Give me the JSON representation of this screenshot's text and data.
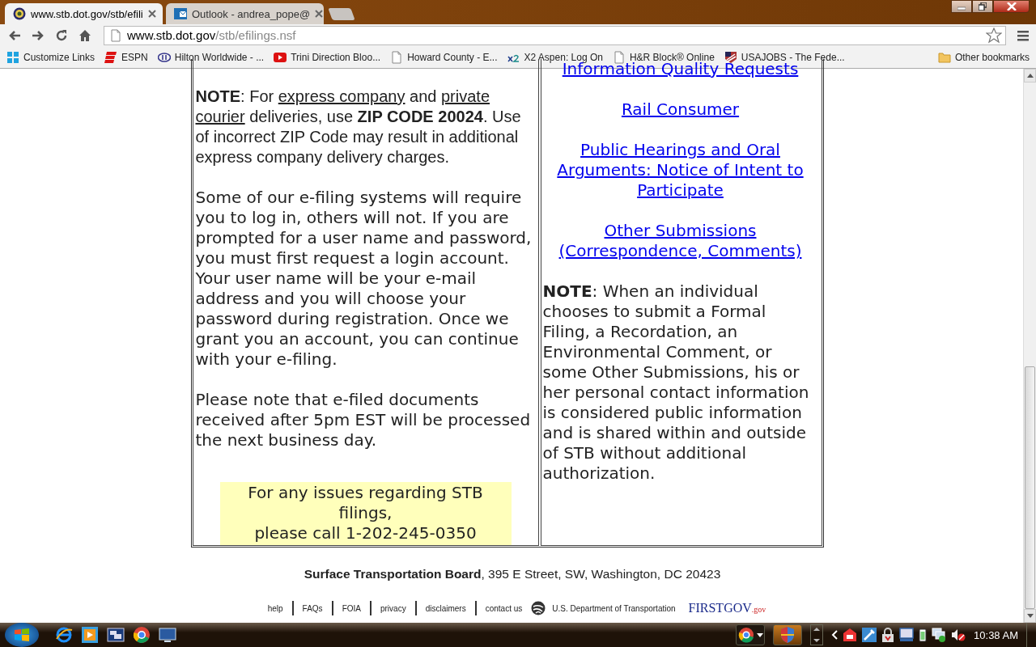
{
  "tabs": [
    {
      "title": "www.stb.dot.gov/stb/efili",
      "selected": true
    },
    {
      "title": "Outlook - andrea_pope@",
      "selected": false
    }
  ],
  "address": {
    "host": "www.stb.dot.gov",
    "path": "/stb/efilings.nsf"
  },
  "bookmarks": [
    {
      "label": "Customize Links"
    },
    {
      "label": "ESPN"
    },
    {
      "label": "Hilton Worldwide - ..."
    },
    {
      "label": "Trini Direction Bloo..."
    },
    {
      "label": "Howard County - E..."
    },
    {
      "label": "X2 Aspen: Log On"
    },
    {
      "label": "H&R Block® Online"
    },
    {
      "label": "USAJOBS - The Fede..."
    }
  ],
  "other_bookmarks": "Other bookmarks",
  "left_column": {
    "note": [
      {
        "text": "NOTE",
        "kind": "bold"
      },
      {
        "text": ": For ",
        "kind": "plain"
      },
      {
        "text": "express company",
        "kind": "underline"
      },
      {
        "text": " and ",
        "kind": "plain"
      },
      {
        "text": "private courier",
        "kind": "underline"
      },
      {
        "text": " deliveries, use ",
        "kind": "plain"
      },
      {
        "text": "ZIP CODE 20024",
        "kind": "bold"
      },
      {
        "text": ". Use of incorrect ZIP Code may result in additional express company delivery charges.",
        "kind": "plain"
      }
    ],
    "paragraphs": [
      "Some of our e-filing systems will require you to log in, others will not. If you are prompted for a user name and password, you must first request a login account. Your user name will be your e-mail address and you will choose your password during registration. Once we grant you an account, you can continue with your e-filing.",
      "Please note that e-filed documents received after 5pm EST will be processed the next business day."
    ],
    "notice": [
      "For any issues regarding STB filings,",
      "please call 1-202-245-0350"
    ]
  },
  "right_column": {
    "links": [
      "Information Quality Requests",
      "Rail Consumer",
      "Public Hearings and Oral Arguments: Notice of Intent to Participate",
      "Other Submissions (Correspondence, Comments)"
    ],
    "note": "**NOTE**: When an individual chooses to submit a Formal Filing, a Recordation, an Environmental Comment, or some Other Submissions, his or her personal contact information is considered public information and is shared within and outside of STB without additional authorization."
  },
  "footer": {
    "address": "**Surface Transportation Board**, 395 E Street, SW, Washington, DC  20423",
    "links": [
      "help",
      "FAQs",
      "FOIA",
      "privacy",
      "disclaimers",
      "contact us"
    ],
    "dot": "U.S. Department of Transportation",
    "firstgov": "FIRSTGOV",
    "firstgov_suffix": ".gov"
  },
  "taskbar": {
    "clock": "10:38 AM"
  }
}
